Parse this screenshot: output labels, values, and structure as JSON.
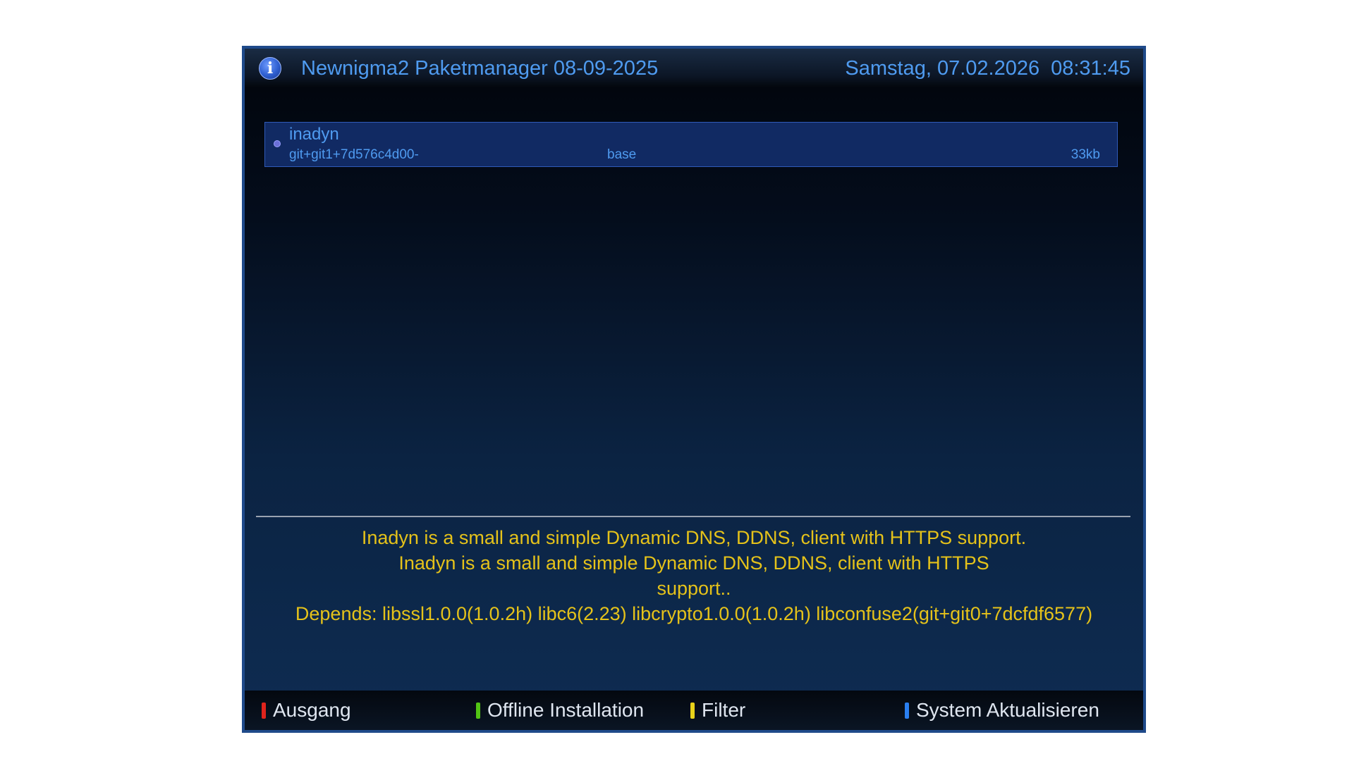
{
  "header": {
    "icon": "info-icon",
    "title": "Newnigma2 Paketmanager 08-09-2025",
    "date": "Samstag, 07.02.2026",
    "time": "08:31:45"
  },
  "package_list": [
    {
      "name": "inadyn",
      "version": "git+git1+7d576c4d00-",
      "section": "base",
      "size": "33kb",
      "selected": true
    }
  ],
  "description": {
    "lines": [
      "Inadyn is a small and simple Dynamic DNS, DDNS, client with HTTPS support.",
      "Inadyn is a small and simple Dynamic DNS, DDNS, client with HTTPS",
      "support..",
      "Depends: libssl1.0.0(1.0.2h) libc6(2.23) libcrypto1.0.0(1.0.2h) libconfuse2(git+git0+7dcfdf6577)"
    ]
  },
  "footer": {
    "keys": [
      {
        "color": "#e0241c",
        "label": "Ausgang"
      },
      {
        "color": "#52c414",
        "label": "Offline Installation"
      },
      {
        "color": "#e8d21a",
        "label": "Filter"
      },
      {
        "color": "#2a7ff0",
        "label": "System Aktualisieren"
      }
    ]
  }
}
